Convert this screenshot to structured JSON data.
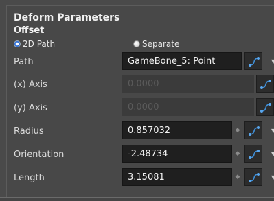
{
  "section_title": "Deform Parameters",
  "offset_title": "Offset",
  "offset_modes": {
    "path_2d": "2D Path",
    "separate": "Separate",
    "selected": "2D Path"
  },
  "rows": {
    "path": {
      "label": "Path",
      "value": "GameBone_5: Point"
    },
    "x_axis": {
      "label": "(x) Axis",
      "value": "0.0000"
    },
    "y_axis": {
      "label": "(y) Axis",
      "value": "0.0000"
    },
    "radius": {
      "label": "Radius",
      "value": "0.857032"
    },
    "orientation": {
      "label": "Orientation",
      "value": "-2.48734"
    },
    "length": {
      "label": "Length",
      "value": "3.15081"
    }
  },
  "icons": {
    "function": "function-curve-icon",
    "spin": "spinner-icon",
    "menu": "dropdown-arrow-icon"
  },
  "colors": {
    "accent": "#2f6fd6",
    "curve_icon": "#3f8fd8"
  }
}
